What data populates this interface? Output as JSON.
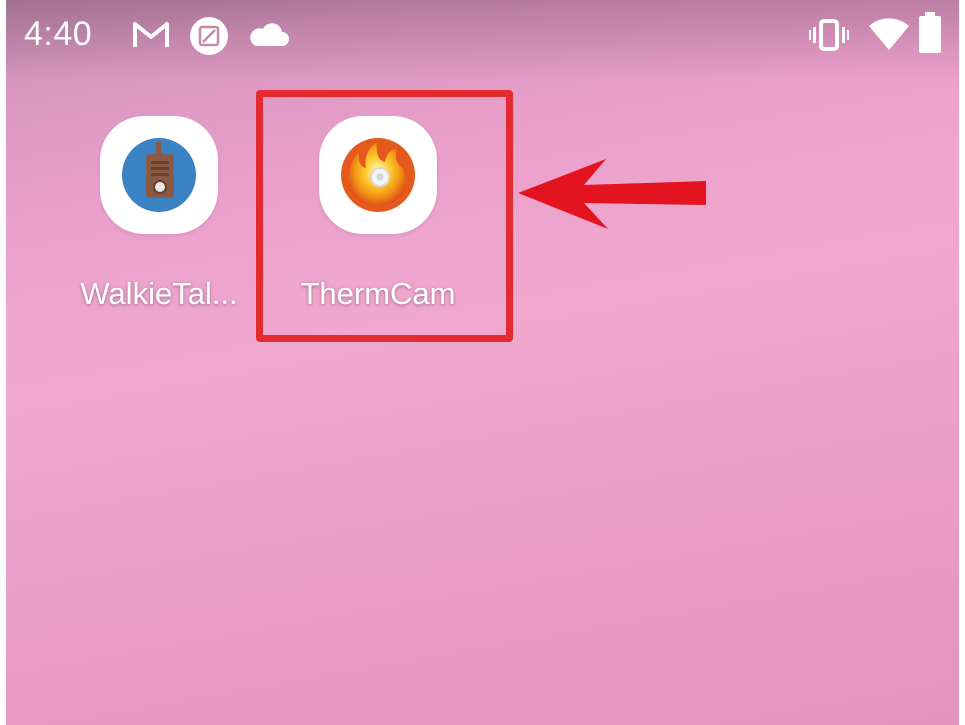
{
  "status_bar": {
    "time": "4:40",
    "left_icons": [
      "gmail-icon",
      "calendar-icon",
      "cloud-icon"
    ],
    "right_icons": [
      "vibrate-icon",
      "wifi-icon",
      "battery-icon"
    ]
  },
  "apps": [
    {
      "label": "WalkieTal...",
      "icon": "walkie-talkie-icon"
    },
    {
      "label": "ThermCam",
      "icon": "thermcam-flame-icon"
    }
  ],
  "annotation": {
    "highlight_color": "#e32a2f",
    "arrow_color": "#e3141f",
    "target": "ThermCam"
  },
  "colors": {
    "wallpaper": "#eaa0cb",
    "walkie_icon_bg": "#3b82c4",
    "walkie_icon_fg": "#8a5a44",
    "thermcam_flame": "#f2a516"
  }
}
